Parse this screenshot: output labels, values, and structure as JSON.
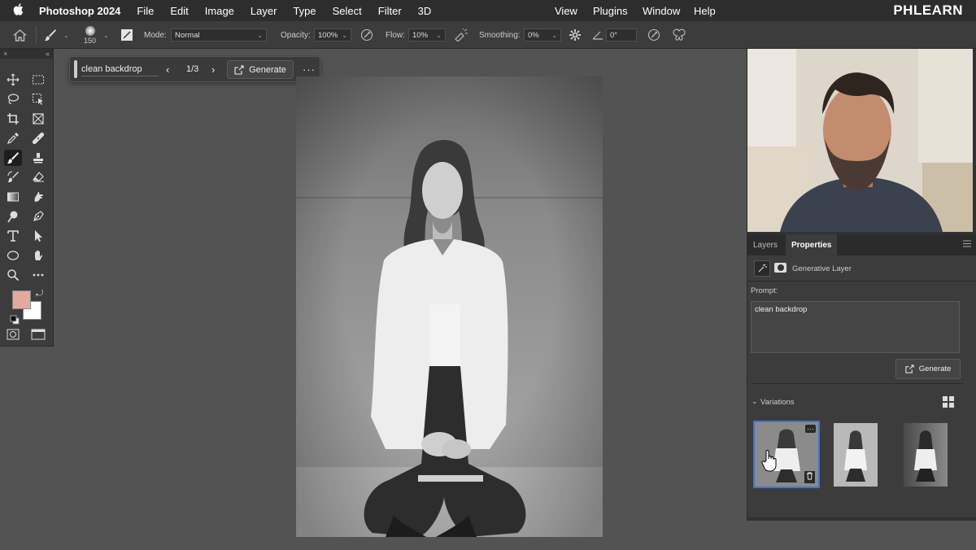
{
  "menubar": {
    "app_name": "Photoshop 2024",
    "items": [
      "File",
      "Edit",
      "Image",
      "Layer",
      "Type",
      "Select",
      "Filter",
      "3D"
    ],
    "right_items": [
      "View",
      "Plugins",
      "Window",
      "Help"
    ],
    "brand": "PHLEARN"
  },
  "options": {
    "brush_size": "150",
    "mode_label": "Mode:",
    "mode_value": "Normal",
    "opacity_label": "Opacity:",
    "opacity_value": "100%",
    "flow_label": "Flow:",
    "flow_value": "10%",
    "smoothing_label": "Smoothing:",
    "smoothing_value": "0%",
    "angle_value": "0°"
  },
  "context_bar": {
    "prompt": "clean backdrop",
    "counter": "1/3",
    "generate_label": "Generate"
  },
  "panel": {
    "tabs": [
      "Layers",
      "Properties"
    ],
    "active_tab": "Properties",
    "layer_type": "Generative Layer",
    "prompt_label": "Prompt:",
    "prompt_value": "clean backdrop",
    "generate_label": "Generate",
    "variations_label": "Variations"
  },
  "colors": {
    "foreground": "#e3a99b",
    "background": "#ffffff",
    "selection_accent": "#3b78d4"
  },
  "icons": {
    "tools": [
      "move-icon",
      "marquee-icon",
      "lasso-icon",
      "object-select-icon",
      "crop-icon",
      "frame-icon",
      "eyedropper-icon",
      "healing-icon",
      "brush-icon",
      "stamp-icon",
      "history-brush-icon",
      "eraser-icon",
      "gradient-icon",
      "smudge-icon",
      "dodge-icon",
      "pen-icon",
      "type-icon",
      "path-select-icon",
      "rectangle-icon",
      "hand-icon",
      "zoom-icon",
      "more-tools-icon"
    ]
  }
}
